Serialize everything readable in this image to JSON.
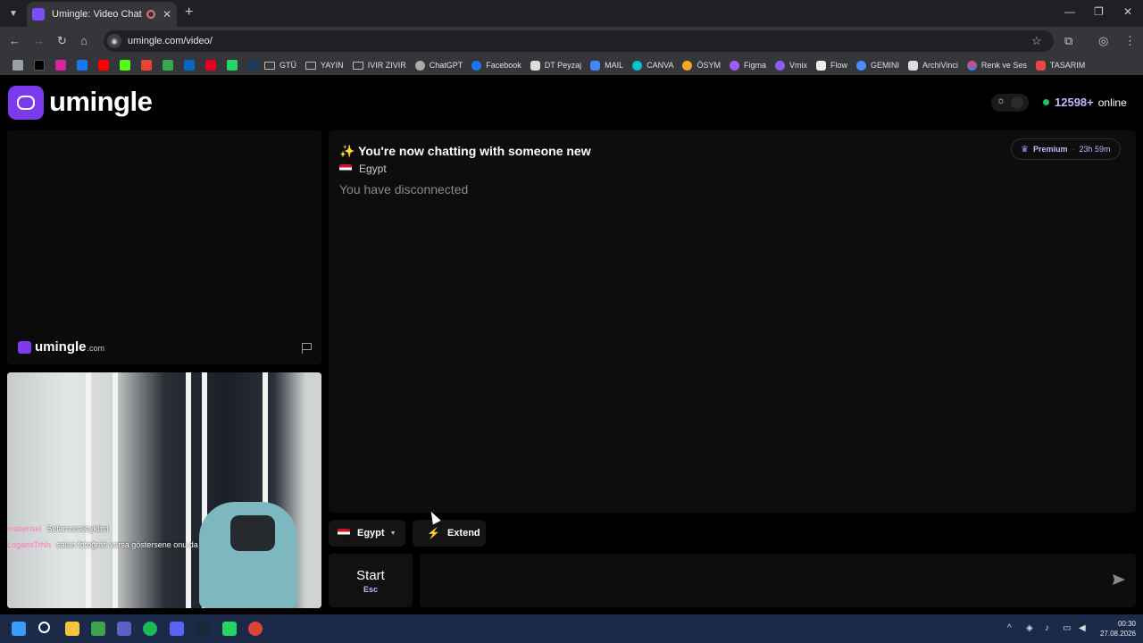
{
  "browser": {
    "tab_title": "Umingle: Video Chat with St",
    "url": "umingle.com/video/",
    "bookmarks": [
      "GTÜ",
      "YAYIN",
      "IVIR ZIVIR",
      "ChatGPT",
      "Facebook",
      "DT Peyzaj",
      "MAIL",
      "CANVA",
      "ÖSYM",
      "Figma",
      "Vmix",
      "Flow",
      "GEMINI",
      "ArchiVinci",
      "Renk ve Ses",
      "TASARIM"
    ]
  },
  "header": {
    "logo_text": "umingle",
    "online_count": "12598+",
    "online_label": "online"
  },
  "remote": {
    "watermark": "umingle",
    "watermark_suffix": ".com"
  },
  "local_overlay": [
    {
      "nick": "masensei",
      "msg": "Selamunaleyküm"
    },
    {
      "nick": "LogansTrhls",
      "msg": "salan fotoğrafı varsa göstersene onu da"
    }
  ],
  "chat": {
    "title": "✨ You're now chatting with someone new",
    "country": "Egypt",
    "status": "You have disconnected",
    "premium_label": "Premium",
    "premium_time": "23h 59m"
  },
  "controls": {
    "country_filter": "Egypt",
    "extend_label": "Extend",
    "start_label": "Start",
    "start_shortcut": "Esc",
    "message_placeholder": ""
  },
  "taskbar": {
    "time": "00:30",
    "date": "27.08.2026"
  },
  "colors": {
    "accent": "#7c3aed",
    "online_dot": "#22c55e"
  }
}
